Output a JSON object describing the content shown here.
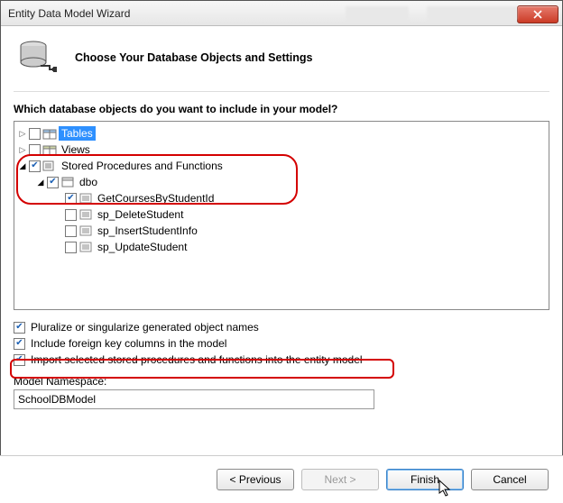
{
  "window": {
    "title": "Entity Data Model Wizard"
  },
  "header": {
    "title": "Choose Your Database Objects and Settings"
  },
  "question": "Which database objects do you want to include in your model?",
  "tree": {
    "tables": {
      "label": "Tables",
      "expanded": false,
      "checked": "unchecked",
      "selected": true
    },
    "views": {
      "label": "Views",
      "expanded": false,
      "checked": "unchecked"
    },
    "sprocs": {
      "label": "Stored Procedures and Functions",
      "expanded": true,
      "checked": "checked",
      "schemas": [
        {
          "label": "dbo",
          "expanded": true,
          "checked": "checked",
          "items": [
            {
              "label": "GetCoursesByStudentId",
              "checked": "checked"
            },
            {
              "label": "sp_DeleteStudent",
              "checked": "unchecked"
            },
            {
              "label": "sp_InsertStudentInfo",
              "checked": "unchecked"
            },
            {
              "label": "sp_UpdateStudent",
              "checked": "unchecked"
            }
          ]
        }
      ]
    }
  },
  "options": {
    "pluralize": {
      "label": "Pluralize or singularize generated object names",
      "checked": true
    },
    "fk": {
      "label": "Include foreign key columns in the model",
      "checked": true
    },
    "import_sp": {
      "label": "Import selected stored procedures and functions into the entity model",
      "checked": true
    }
  },
  "namespace": {
    "label": "Model Namespace:",
    "value": "SchoolDBModel"
  },
  "buttons": {
    "previous": "< Previous",
    "next": "Next >",
    "finish": "Finish",
    "cancel": "Cancel"
  }
}
